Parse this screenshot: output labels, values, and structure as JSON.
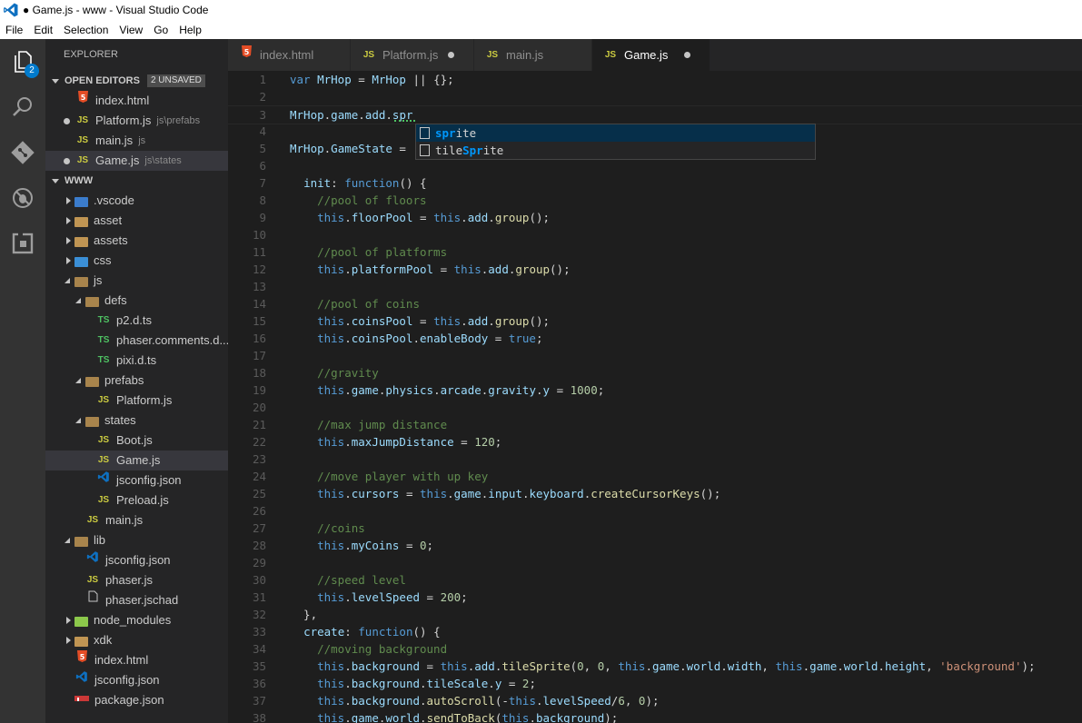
{
  "window": {
    "title": "● Game.js - www - Visual Studio Code"
  },
  "menu": [
    "File",
    "Edit",
    "Selection",
    "View",
    "Go",
    "Help"
  ],
  "activity_bar": {
    "items": [
      "explorer-icon",
      "search-icon",
      "git-icon",
      "debug-icon",
      "extensions-icon"
    ],
    "explorer_badge": "2"
  },
  "sidebar": {
    "title": "EXPLORER",
    "open_editors": {
      "label": "OPEN EDITORS",
      "badge": "2 UNSAVED",
      "items": [
        {
          "icon": "5",
          "name": "index.html",
          "desc": "",
          "dirty": false
        },
        {
          "icon": "JS",
          "name": "Platform.js",
          "desc": "js\\prefabs",
          "dirty": true
        },
        {
          "icon": "JS",
          "name": "main.js",
          "desc": "js",
          "dirty": false
        },
        {
          "icon": "JS",
          "name": "Game.js",
          "desc": "js\\states",
          "dirty": true
        }
      ]
    },
    "workspace": {
      "label": "WWW",
      "tree": [
        {
          "name": ".vscode",
          "type": "folder"
        },
        {
          "name": "asset",
          "type": "folder"
        },
        {
          "name": "assets",
          "type": "folder"
        },
        {
          "name": "css",
          "type": "folder"
        },
        {
          "name": "js",
          "type": "folder"
        },
        {
          "name": "defs",
          "type": "folder"
        },
        {
          "name": "p2.d.ts",
          "icon": "TS"
        },
        {
          "name": "phaser.comments.d...",
          "icon": "TS"
        },
        {
          "name": "pixi.d.ts",
          "icon": "TS"
        },
        {
          "name": "prefabs",
          "type": "folder"
        },
        {
          "name": "Platform.js",
          "icon": "JS"
        },
        {
          "name": "states",
          "type": "folder"
        },
        {
          "name": "Boot.js",
          "icon": "JS"
        },
        {
          "name": "Game.js",
          "icon": "JS"
        },
        {
          "name": "jsconfig.json",
          "icon": "vs"
        },
        {
          "name": "Preload.js",
          "icon": "JS"
        },
        {
          "name": "main.js",
          "icon": "JS"
        },
        {
          "name": "lib",
          "type": "folder"
        },
        {
          "name": "jsconfig.json",
          "icon": "vs"
        },
        {
          "name": "phaser.js",
          "icon": "JS"
        },
        {
          "name": "phaser.jschad",
          "icon": "file"
        },
        {
          "name": "node_modules",
          "type": "folder"
        },
        {
          "name": "xdk",
          "type": "folder"
        },
        {
          "name": "index.html",
          "icon": "5"
        },
        {
          "name": "jsconfig.json",
          "icon": "vs"
        },
        {
          "name": "package.json",
          "icon": "npm"
        }
      ]
    }
  },
  "tabs": [
    {
      "icon": "5",
      "label": "index.html",
      "dirty": false,
      "active": false
    },
    {
      "icon": "JS",
      "label": "Platform.js",
      "dirty": true,
      "active": false
    },
    {
      "icon": "JS",
      "label": "main.js",
      "dirty": false,
      "active": false
    },
    {
      "icon": "JS",
      "label": "Game.js",
      "dirty": true,
      "active": true
    }
  ],
  "editor": {
    "lines": [
      [
        [
          "kw",
          "var "
        ],
        [
          "id",
          "MrHop"
        ],
        [
          "pl",
          " = "
        ],
        [
          "id",
          "MrHop"
        ],
        [
          "pl",
          " || {};"
        ]
      ],
      [],
      [
        [
          "id",
          "MrHop"
        ],
        [
          "pl",
          "."
        ],
        [
          "id",
          "game"
        ],
        [
          "pl",
          "."
        ],
        [
          "id",
          "add"
        ],
        [
          "pl",
          "."
        ],
        [
          "id",
          "spr"
        ]
      ],
      [],
      [
        [
          "id",
          "MrHop"
        ],
        [
          "pl",
          "."
        ],
        [
          "id",
          "GameState"
        ],
        [
          "pl",
          " = "
        ]
      ],
      [],
      [
        [
          "pl",
          "  "
        ],
        [
          "id",
          "init"
        ],
        [
          "pl",
          ": "
        ],
        [
          "kw",
          "function"
        ],
        [
          "pl",
          "() {"
        ]
      ],
      [
        [
          "cm",
          "    //pool of floors"
        ]
      ],
      [
        [
          "pl",
          "    "
        ],
        [
          "kw",
          "this"
        ],
        [
          "pl",
          "."
        ],
        [
          "id",
          "floorPool"
        ],
        [
          "pl",
          " = "
        ],
        [
          "kw",
          "this"
        ],
        [
          "pl",
          "."
        ],
        [
          "id",
          "add"
        ],
        [
          "pl",
          "."
        ],
        [
          "fn",
          "group"
        ],
        [
          "pl",
          "();"
        ]
      ],
      [],
      [
        [
          "cm",
          "    //pool of platforms"
        ]
      ],
      [
        [
          "pl",
          "    "
        ],
        [
          "kw",
          "this"
        ],
        [
          "pl",
          "."
        ],
        [
          "id",
          "platformPool"
        ],
        [
          "pl",
          " = "
        ],
        [
          "kw",
          "this"
        ],
        [
          "pl",
          "."
        ],
        [
          "id",
          "add"
        ],
        [
          "pl",
          "."
        ],
        [
          "fn",
          "group"
        ],
        [
          "pl",
          "();"
        ]
      ],
      [],
      [
        [
          "cm",
          "    //pool of coins"
        ]
      ],
      [
        [
          "pl",
          "    "
        ],
        [
          "kw",
          "this"
        ],
        [
          "pl",
          "."
        ],
        [
          "id",
          "coinsPool"
        ],
        [
          "pl",
          " = "
        ],
        [
          "kw",
          "this"
        ],
        [
          "pl",
          "."
        ],
        [
          "id",
          "add"
        ],
        [
          "pl",
          "."
        ],
        [
          "fn",
          "group"
        ],
        [
          "pl",
          "();"
        ]
      ],
      [
        [
          "pl",
          "    "
        ],
        [
          "kw",
          "this"
        ],
        [
          "pl",
          "."
        ],
        [
          "id",
          "coinsPool"
        ],
        [
          "pl",
          "."
        ],
        [
          "id",
          "enableBody"
        ],
        [
          "pl",
          " = "
        ],
        [
          "kw",
          "true"
        ],
        [
          "pl",
          ";"
        ]
      ],
      [],
      [
        [
          "cm",
          "    //gravity"
        ]
      ],
      [
        [
          "pl",
          "    "
        ],
        [
          "kw",
          "this"
        ],
        [
          "pl",
          "."
        ],
        [
          "id",
          "game"
        ],
        [
          "pl",
          "."
        ],
        [
          "id",
          "physics"
        ],
        [
          "pl",
          "."
        ],
        [
          "id",
          "arcade"
        ],
        [
          "pl",
          "."
        ],
        [
          "id",
          "gravity"
        ],
        [
          "pl",
          "."
        ],
        [
          "id",
          "y"
        ],
        [
          "pl",
          " = "
        ],
        [
          "nm",
          "1000"
        ],
        [
          "pl",
          ";"
        ]
      ],
      [],
      [
        [
          "cm",
          "    //max jump distance"
        ]
      ],
      [
        [
          "pl",
          "    "
        ],
        [
          "kw",
          "this"
        ],
        [
          "pl",
          "."
        ],
        [
          "id",
          "maxJumpDistance"
        ],
        [
          "pl",
          " = "
        ],
        [
          "nm",
          "120"
        ],
        [
          "pl",
          ";"
        ]
      ],
      [],
      [
        [
          "cm",
          "    //move player with up key"
        ]
      ],
      [
        [
          "pl",
          "    "
        ],
        [
          "kw",
          "this"
        ],
        [
          "pl",
          "."
        ],
        [
          "id",
          "cursors"
        ],
        [
          "pl",
          " = "
        ],
        [
          "kw",
          "this"
        ],
        [
          "pl",
          "."
        ],
        [
          "id",
          "game"
        ],
        [
          "pl",
          "."
        ],
        [
          "id",
          "input"
        ],
        [
          "pl",
          "."
        ],
        [
          "id",
          "keyboard"
        ],
        [
          "pl",
          "."
        ],
        [
          "fn",
          "createCursorKeys"
        ],
        [
          "pl",
          "();"
        ]
      ],
      [],
      [
        [
          "cm",
          "    //coins"
        ]
      ],
      [
        [
          "pl",
          "    "
        ],
        [
          "kw",
          "this"
        ],
        [
          "pl",
          "."
        ],
        [
          "id",
          "myCoins"
        ],
        [
          "pl",
          " = "
        ],
        [
          "nm",
          "0"
        ],
        [
          "pl",
          ";"
        ]
      ],
      [],
      [
        [
          "cm",
          "    //speed level"
        ]
      ],
      [
        [
          "pl",
          "    "
        ],
        [
          "kw",
          "this"
        ],
        [
          "pl",
          "."
        ],
        [
          "id",
          "levelSpeed"
        ],
        [
          "pl",
          " = "
        ],
        [
          "nm",
          "200"
        ],
        [
          "pl",
          ";"
        ]
      ],
      [
        [
          "pl",
          "  },"
        ]
      ],
      [
        [
          "pl",
          "  "
        ],
        [
          "id",
          "create"
        ],
        [
          "pl",
          ": "
        ],
        [
          "kw",
          "function"
        ],
        [
          "pl",
          "() {"
        ]
      ],
      [
        [
          "cm",
          "    //moving background"
        ]
      ],
      [
        [
          "pl",
          "    "
        ],
        [
          "kw",
          "this"
        ],
        [
          "pl",
          "."
        ],
        [
          "id",
          "background"
        ],
        [
          "pl",
          " = "
        ],
        [
          "kw",
          "this"
        ],
        [
          "pl",
          "."
        ],
        [
          "id",
          "add"
        ],
        [
          "pl",
          "."
        ],
        [
          "fn",
          "tileSprite"
        ],
        [
          "pl",
          "("
        ],
        [
          "nm",
          "0"
        ],
        [
          "pl",
          ", "
        ],
        [
          "nm",
          "0"
        ],
        [
          "pl",
          ", "
        ],
        [
          "kw",
          "this"
        ],
        [
          "pl",
          "."
        ],
        [
          "id",
          "game"
        ],
        [
          "pl",
          "."
        ],
        [
          "id",
          "world"
        ],
        [
          "pl",
          "."
        ],
        [
          "id",
          "width"
        ],
        [
          "pl",
          ", "
        ],
        [
          "kw",
          "this"
        ],
        [
          "pl",
          "."
        ],
        [
          "id",
          "game"
        ],
        [
          "pl",
          "."
        ],
        [
          "id",
          "world"
        ],
        [
          "pl",
          "."
        ],
        [
          "id",
          "height"
        ],
        [
          "pl",
          ", "
        ],
        [
          "st",
          "'background'"
        ],
        [
          "pl",
          ");"
        ]
      ],
      [
        [
          "pl",
          "    "
        ],
        [
          "kw",
          "this"
        ],
        [
          "pl",
          "."
        ],
        [
          "id",
          "background"
        ],
        [
          "pl",
          "."
        ],
        [
          "id",
          "tileScale"
        ],
        [
          "pl",
          "."
        ],
        [
          "id",
          "y"
        ],
        [
          "pl",
          " = "
        ],
        [
          "nm",
          "2"
        ],
        [
          "pl",
          ";"
        ]
      ],
      [
        [
          "pl",
          "    "
        ],
        [
          "kw",
          "this"
        ],
        [
          "pl",
          "."
        ],
        [
          "id",
          "background"
        ],
        [
          "pl",
          "."
        ],
        [
          "fn",
          "autoScroll"
        ],
        [
          "pl",
          "(-"
        ],
        [
          "kw",
          "this"
        ],
        [
          "pl",
          "."
        ],
        [
          "id",
          "levelSpeed"
        ],
        [
          "pl",
          "/"
        ],
        [
          "nm",
          "6"
        ],
        [
          "pl",
          ", "
        ],
        [
          "nm",
          "0"
        ],
        [
          "pl",
          ");"
        ]
      ],
      [
        [
          "pl",
          "    "
        ],
        [
          "kw",
          "this"
        ],
        [
          "pl",
          "."
        ],
        [
          "id",
          "game"
        ],
        [
          "pl",
          "."
        ],
        [
          "id",
          "world"
        ],
        [
          "pl",
          "."
        ],
        [
          "fn",
          "sendToBack"
        ],
        [
          "pl",
          "("
        ],
        [
          "kw",
          "this"
        ],
        [
          "pl",
          "."
        ],
        [
          "id",
          "background"
        ],
        [
          "pl",
          ");"
        ]
      ]
    ]
  },
  "suggest": {
    "items": [
      {
        "prefix": "",
        "match": "spr",
        "rest": "ite",
        "selected": true
      },
      {
        "prefix": "tile",
        "match": "Spr",
        "rest": "ite",
        "selected": false
      }
    ]
  },
  "colors": {
    "accent": "#007acc",
    "keyword": "#569cd6",
    "identifier": "#9cdcfe",
    "function": "#dcdcaa",
    "comment": "#608b4e",
    "number": "#b5cea8",
    "string": "#ce9178"
  }
}
